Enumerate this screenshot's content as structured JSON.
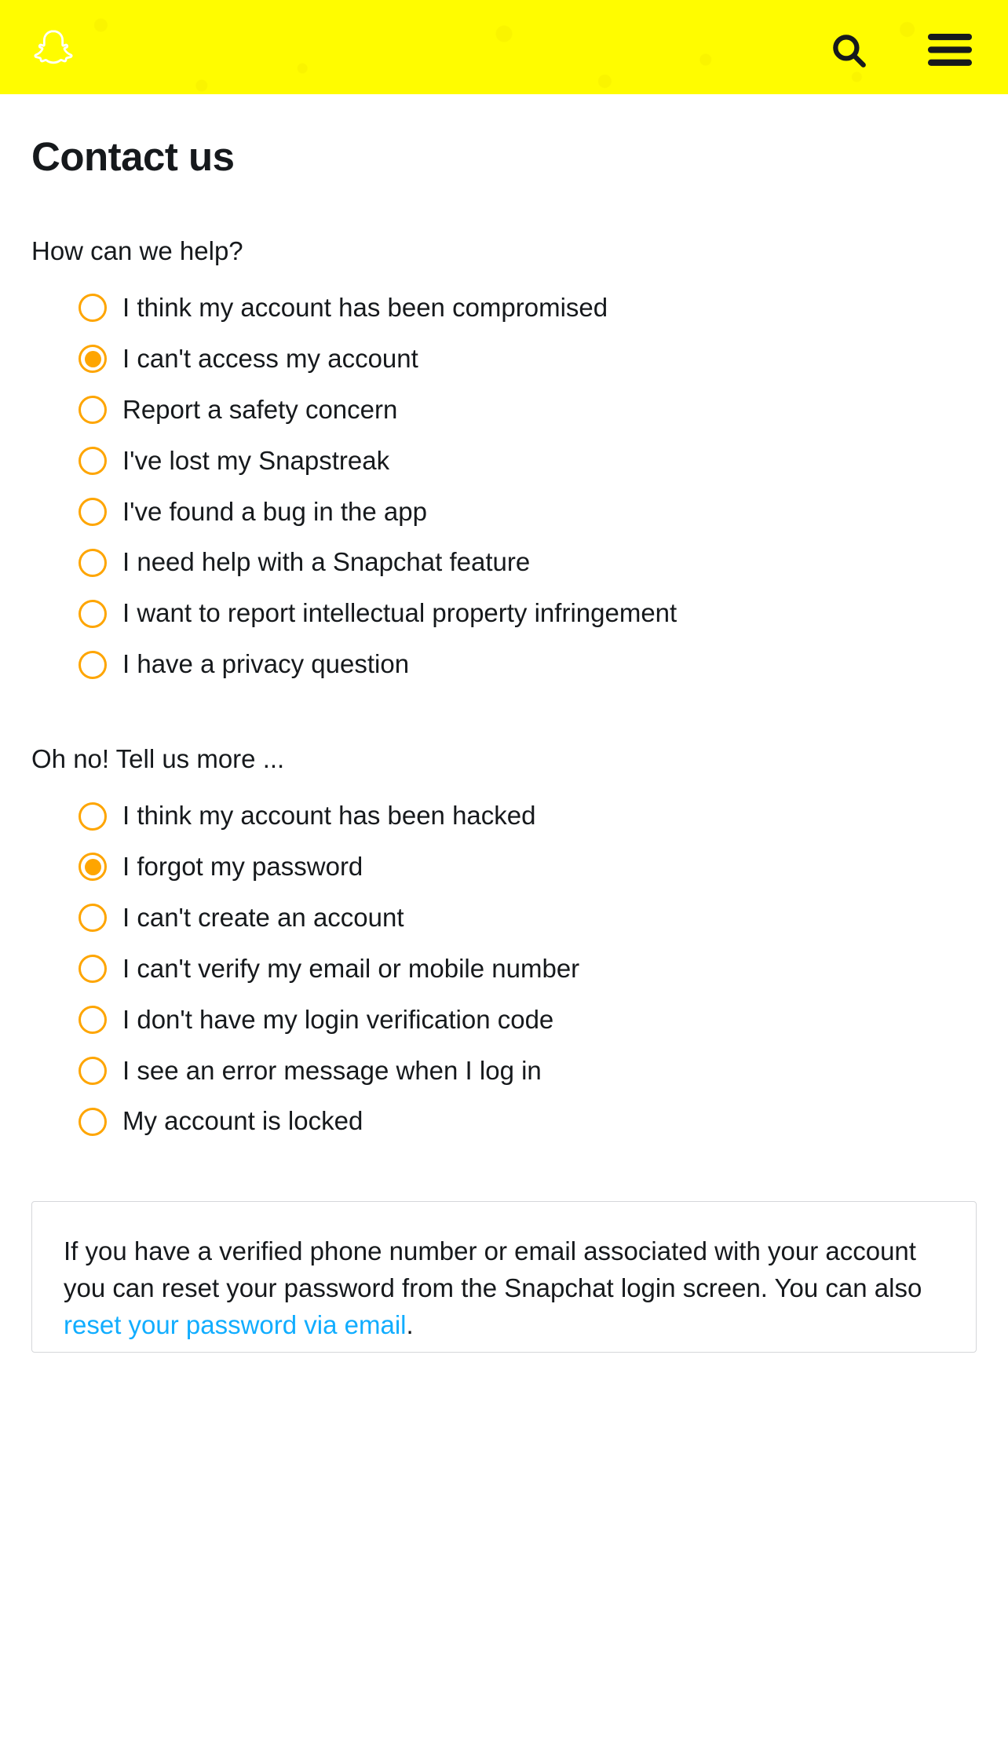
{
  "header": {
    "logo_name": "snapchat-ghost-icon",
    "search_name": "search-icon",
    "menu_name": "menu-icon"
  },
  "page": {
    "title": "Contact us"
  },
  "question1": {
    "label": "How can we help?",
    "options": [
      {
        "label": "I think my account has been compromised",
        "selected": false
      },
      {
        "label": "I can't access my account",
        "selected": true
      },
      {
        "label": "Report a safety concern",
        "selected": false
      },
      {
        "label": "I've lost my Snapstreak",
        "selected": false
      },
      {
        "label": "I've found a bug in the app",
        "selected": false
      },
      {
        "label": "I need help with a Snapchat feature",
        "selected": false
      },
      {
        "label": "I want to report intellectual property infringement",
        "selected": false
      },
      {
        "label": "I have a privacy question",
        "selected": false
      }
    ]
  },
  "question2": {
    "label": "Oh no! Tell us more ...",
    "options": [
      {
        "label": "I think my account has been hacked",
        "selected": false
      },
      {
        "label": "I forgot my password",
        "selected": true
      },
      {
        "label": "I can't create an account",
        "selected": false
      },
      {
        "label": "I can't verify my email or mobile number",
        "selected": false
      },
      {
        "label": "I don't have my login verification code",
        "selected": false
      },
      {
        "label": "I see an error message when I log in",
        "selected": false
      },
      {
        "label": "My account is locked",
        "selected": false
      }
    ]
  },
  "info": {
    "text_before": "If you have a verified phone number or email associated with your account you can reset your password from the Snapchat login screen. You can also ",
    "link_text": "reset your password via email",
    "text_after": "."
  }
}
